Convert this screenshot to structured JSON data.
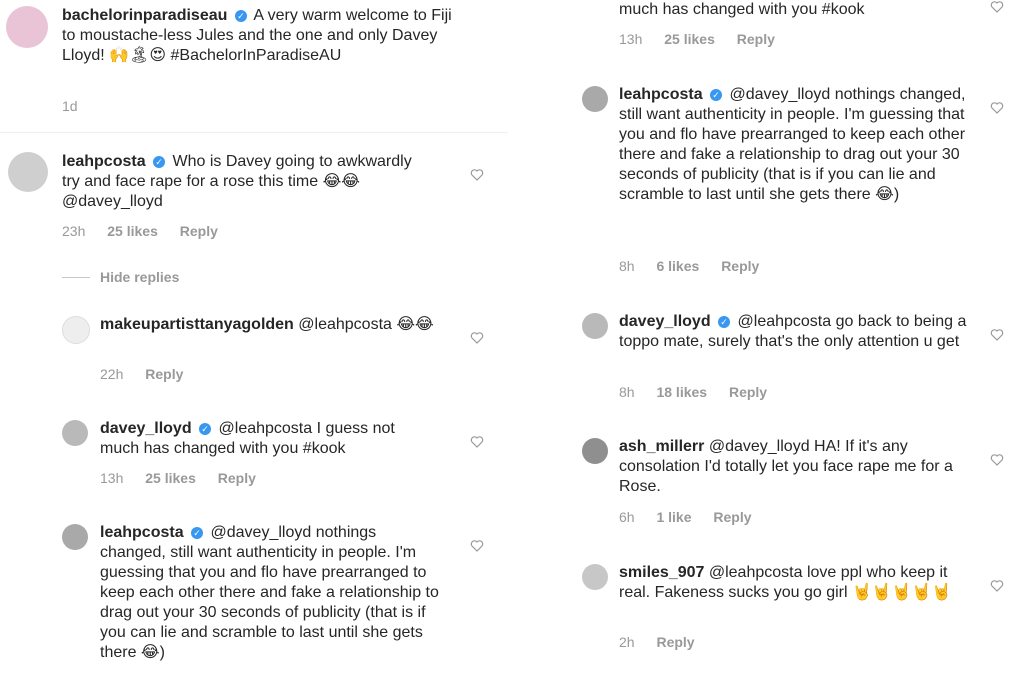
{
  "left": {
    "post": {
      "username": "bachelorinparadiseau",
      "text": "A very warm welcome to Fiji to moustache-less Jules and the one and only Davey Lloyd! 🙌🏝😍 #BachelorInParadiseAU",
      "time": "1d"
    },
    "comments": [
      {
        "username": "leahpcosta",
        "text": "Who is Davey going to awkwardly try and face rape for a rose this time 😂😂 @davey_lloyd",
        "time": "23h",
        "likes": "25 likes",
        "reply": "Reply"
      },
      {
        "username": "makeupartisttanyagolden",
        "text": "@leahpcosta 😂😂",
        "time": "22h",
        "reply": "Reply"
      },
      {
        "username": "davey_lloyd",
        "text": "@leahpcosta I guess not much has changed with you #kook",
        "time": "13h",
        "likes": "25 likes",
        "reply": "Reply"
      },
      {
        "username": "leahpcosta",
        "text": "@davey_lloyd nothings changed, still want authenticity in people. I'm guessing that you and flo have prearranged to keep each other there and fake a relationship to drag out your 30 seconds of publicity (that is if you can lie and scramble to last until she gets there 😂)"
      }
    ],
    "hide_replies": "Hide replies"
  },
  "right": {
    "top_fragment": {
      "text": "much has changed with you #kook",
      "time": "13h",
      "likes": "25 likes",
      "reply": "Reply"
    },
    "comments": [
      {
        "username": "leahpcosta",
        "text": "@davey_lloyd nothings changed, still want authenticity in people. I'm guessing that you and flo have prearranged to keep each other there and fake a relationship to drag out your 30 seconds of publicity (that is if you can lie and scramble to last until she gets there 😂)",
        "time": "8h",
        "likes": "6 likes",
        "reply": "Reply"
      },
      {
        "username": "davey_lloyd",
        "text": "@leahpcosta go back to being a toppo mate, surely that's the only attention u get",
        "time": "8h",
        "likes": "18 likes",
        "reply": "Reply"
      },
      {
        "username": "ash_millerr",
        "text": "@davey_lloyd HA! If it's any consolation I'd totally let you face rape me for a Rose.",
        "time": "6h",
        "likes": "1 like",
        "reply": "Reply"
      },
      {
        "username": "smiles_907",
        "text": "@leahpcosta love ppl who keep it real. Fakeness sucks you go girl 🤘🤘🤘🤘🤘",
        "time": "2h",
        "reply": "Reply"
      }
    ]
  },
  "colors": {
    "verified": "#3897f0",
    "meta": "#999999",
    "text": "#262626"
  }
}
